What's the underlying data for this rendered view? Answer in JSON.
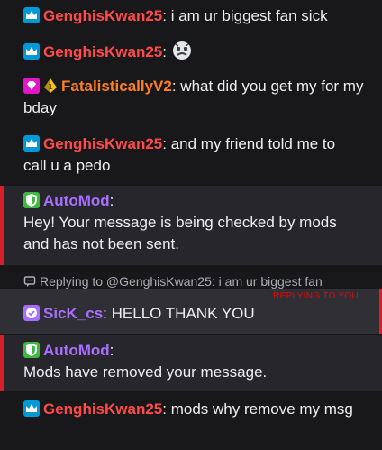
{
  "messages": [
    {
      "user": "GenghisKwan25",
      "badge": "prime-crown-icon",
      "sep": ":",
      "text": " i am ur biggest fan sick"
    },
    {
      "user": "GenghisKwan25",
      "badge": "prime-crown-icon",
      "sep": ":",
      "text": " ",
      "emote": "ghost-face-emote"
    },
    {
      "user": "FatalisticallyV2",
      "badges": [
        "gift-sub-gem-icon",
        "bits-badge-icon"
      ],
      "sep": ":",
      "text": " what did you get my for my bday"
    },
    {
      "user": "GenghisKwan25",
      "badge": "prime-crown-icon",
      "sep": ":",
      "text": " and my friend told me to call u a pedo"
    }
  ],
  "automod_1": {
    "user": "AutoMod",
    "sep": ":",
    "text": "Hey! Your message is being checked by mods and has not been sent."
  },
  "reply": {
    "prefix": "Replying to @GenghisKwan25: i am ur biggest fan",
    "tag": "REPLYING TO YOU",
    "user": "SicK_cs",
    "sep": ":",
    "text": " HELLO THANK YOU"
  },
  "automod_2": {
    "user": "AutoMod",
    "sep": ":",
    "text": "Mods have removed your message."
  },
  "last": {
    "user": "GenghisKwan25",
    "sep": ":",
    "text": " mods why remove my msg"
  },
  "colors": {
    "genghis": "#ff4a4a",
    "fatal": "#ff7f27",
    "automod": "#a970ff",
    "sick": "#a970ff",
    "crown_badge": "#0099d8",
    "shield_badge": "#3cb93f",
    "gem_badge": "#e414c8",
    "background": "#18181b",
    "system_bg": "#26262c",
    "reply_bg": "#2f2f35",
    "alert_red": "#d61f28"
  }
}
